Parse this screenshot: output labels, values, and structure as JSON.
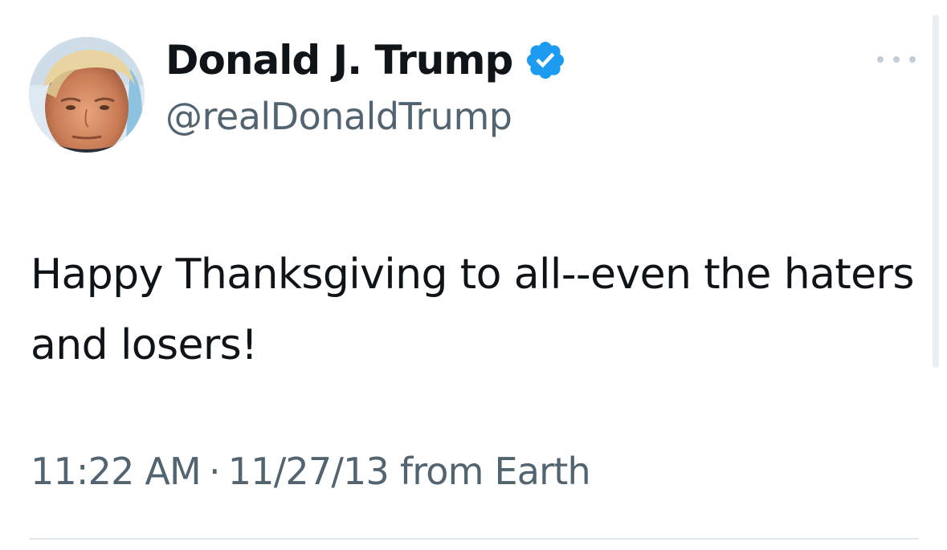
{
  "tweet": {
    "display_name": "Donald J. Trump",
    "handle": "@realDonaldTrump",
    "verified_icon": "verified-badge-icon",
    "more_icon": "more-options-icon",
    "text": "Happy Thanksgiving to all--even the haters and losers!",
    "time": "11:22 AM",
    "separator": "·",
    "date": "11/27/13",
    "source": "from Earth"
  },
  "colors": {
    "primary_text": "#0f1419",
    "secondary_text": "#536471",
    "verified_blue": "#1d9bf0"
  }
}
